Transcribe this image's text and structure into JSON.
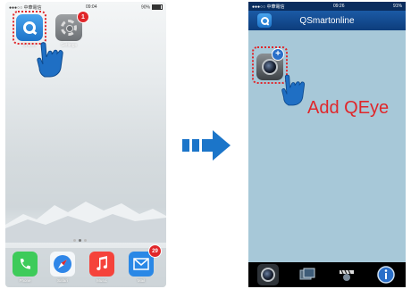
{
  "left_phone": {
    "status": {
      "carrier": "●●●○○ 中華電信",
      "time": "09:04",
      "battery": "90%"
    },
    "apps": [
      {
        "name": "OnLine",
        "icon": "qsmartonline-icon"
      },
      {
        "name": "Settings",
        "icon": "gear-icon",
        "badge": "1"
      }
    ],
    "dock": [
      {
        "name": "Phone",
        "icon": "phone-icon",
        "color": "#3ecb5a"
      },
      {
        "name": "Safari",
        "icon": "compass-icon",
        "color": "#2f86e8"
      },
      {
        "name": "Music",
        "icon": "music-note-icon",
        "color": "#f5433b"
      },
      {
        "name": "Mail",
        "icon": "mail-icon",
        "color": "#2a88e6",
        "badge": "29"
      }
    ]
  },
  "right_phone": {
    "status": {
      "carrier": "●●●○○ 中華電信",
      "time": "09:26",
      "battery": "91%"
    },
    "title": "QSmartonline",
    "add_label": "Add QEye",
    "tabs": [
      "camera-tab-icon",
      "photos-tab-icon",
      "video-tab-icon",
      "info-tab-icon"
    ]
  },
  "colors": {
    "highlight": "#e0262a",
    "arrow": "#1b75c9",
    "header": "#0d3d7c"
  }
}
